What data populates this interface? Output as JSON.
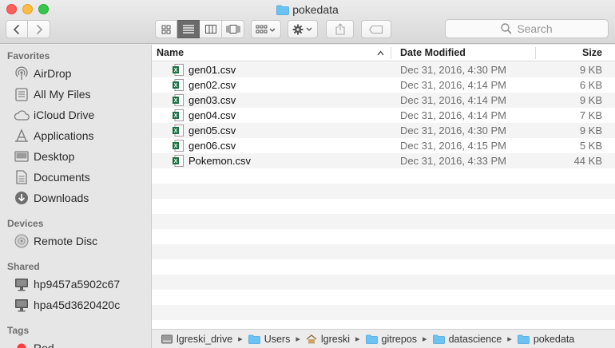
{
  "window": {
    "title": "pokedata"
  },
  "toolbar": {
    "search_placeholder": "Search"
  },
  "sidebar": {
    "favorites_title": "Favorites",
    "favorites": [
      {
        "label": "AirDrop",
        "icon": "airdrop-icon"
      },
      {
        "label": "All My Files",
        "icon": "all-files-icon"
      },
      {
        "label": "iCloud Drive",
        "icon": "cloud-icon"
      },
      {
        "label": "Applications",
        "icon": "applications-icon"
      },
      {
        "label": "Desktop",
        "icon": "desktop-icon"
      },
      {
        "label": "Documents",
        "icon": "documents-icon"
      },
      {
        "label": "Downloads",
        "icon": "downloads-icon"
      }
    ],
    "devices_title": "Devices",
    "devices": [
      {
        "label": "Remote Disc",
        "icon": "disc-icon"
      }
    ],
    "shared_title": "Shared",
    "shared": [
      {
        "label": "hp9457a5902c67",
        "icon": "monitor-icon"
      },
      {
        "label": "hpa45d3620420c",
        "icon": "monitor-icon"
      }
    ],
    "tags_title": "Tags",
    "tags": [
      {
        "label": "Red",
        "color": "#fc3d39"
      }
    ]
  },
  "list": {
    "columns": {
      "name": "Name",
      "date": "Date Modified",
      "size": "Size"
    },
    "files": [
      {
        "name": "gen01.csv",
        "date": "Dec 31, 2016, 4:30 PM",
        "size": "9 KB"
      },
      {
        "name": "gen02.csv",
        "date": "Dec 31, 2016, 4:14 PM",
        "size": "6 KB"
      },
      {
        "name": "gen03.csv",
        "date": "Dec 31, 2016, 4:14 PM",
        "size": "9 KB"
      },
      {
        "name": "gen04.csv",
        "date": "Dec 31, 2016, 4:14 PM",
        "size": "7 KB"
      },
      {
        "name": "gen05.csv",
        "date": "Dec 31, 2016, 4:30 PM",
        "size": "9 KB"
      },
      {
        "name": "gen06.csv",
        "date": "Dec 31, 2016, 4:15 PM",
        "size": "5 KB"
      },
      {
        "name": "Pokemon.csv",
        "date": "Dec 31, 2016, 4:33 PM",
        "size": "44 KB"
      }
    ]
  },
  "pathbar": [
    {
      "label": "lgreski_drive",
      "icon": "drive-icon"
    },
    {
      "label": "Users",
      "icon": "folder-icon"
    },
    {
      "label": "lgreski",
      "icon": "home-icon"
    },
    {
      "label": "gitrepos",
      "icon": "folder-icon"
    },
    {
      "label": "datascience",
      "icon": "folder-icon"
    },
    {
      "label": "pokedata",
      "icon": "folder-icon"
    }
  ],
  "colors": {
    "folder": "#6cc3f3",
    "excel": "#1f7245",
    "selected_view": "#6b6b6b"
  }
}
